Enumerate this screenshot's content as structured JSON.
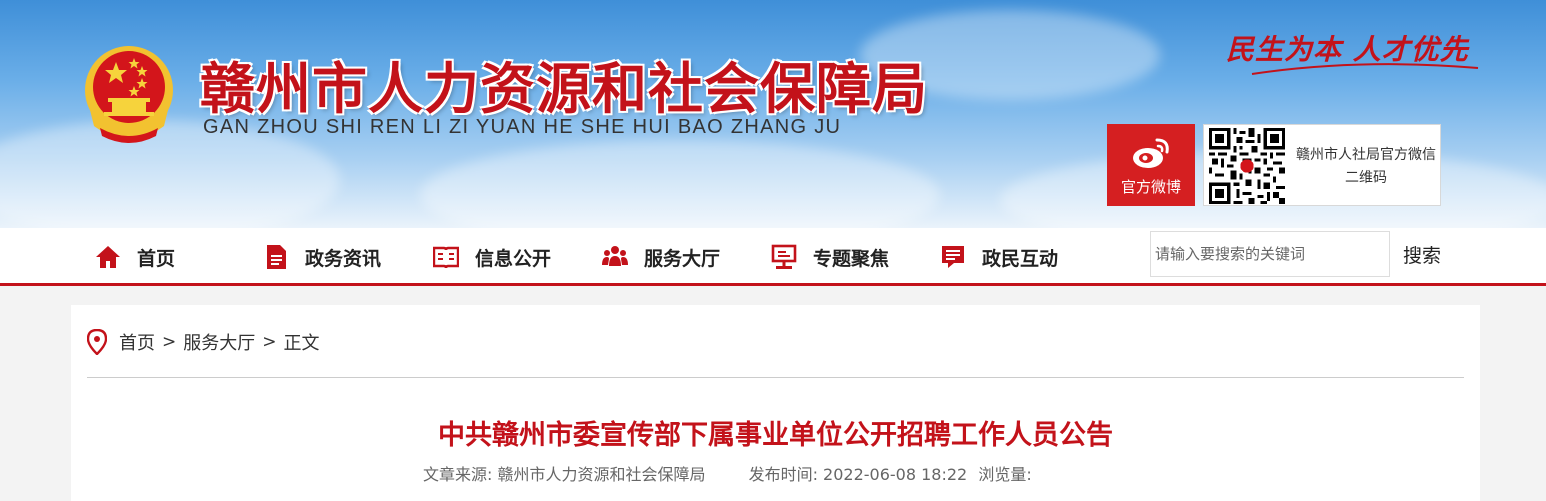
{
  "header": {
    "site_name": "赣州市人力资源和社会保障局",
    "site_pinyin": "GAN ZHOU SHI REN LI ZI YUAN HE SHE HUI BAO ZHANG JU",
    "slogan": "民生为本  人才优先",
    "weibo_label": "官方微博",
    "qr_text": "赣州市人社局官方微信二维码"
  },
  "nav": {
    "items": [
      {
        "label": "首页",
        "icon": "home-icon"
      },
      {
        "label": "政务资讯",
        "icon": "document-icon"
      },
      {
        "label": "信息公开",
        "icon": "open-book-icon"
      },
      {
        "label": "服务大厅",
        "icon": "people-icon"
      },
      {
        "label": "专题聚焦",
        "icon": "presentation-icon"
      },
      {
        "label": "政民互动",
        "icon": "chat-list-icon"
      }
    ],
    "search_placeholder": "请输入要搜索的关键词",
    "search_button": "搜索"
  },
  "breadcrumb": {
    "items": [
      "首页",
      "服务大厅",
      "正文"
    ],
    "separator": ">"
  },
  "article": {
    "title": "中共赣州市委宣传部下属事业单位公开招聘工作人员公告",
    "source": "文章来源: 赣州市人力资源和社会保障局",
    "publish_time": "发布时间:  2022-06-08 18:22",
    "views": "浏览量:"
  },
  "colors": {
    "brand_red": "#c3121a",
    "weibo_red": "#d51f21",
    "sky_blue": "#3f8fd8"
  }
}
